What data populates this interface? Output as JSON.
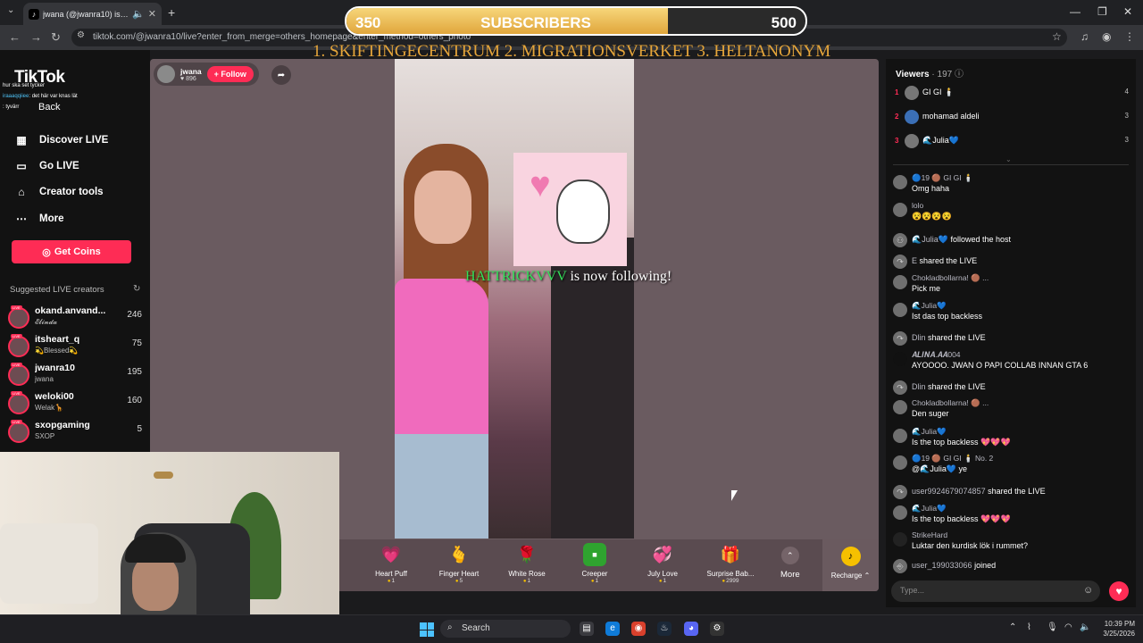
{
  "browser": {
    "tab_title": "jwana (@jwanra10) is LIVE",
    "url": "tiktok.com/@jwanra10/live?enter_from_merge=others_homepage&enter_method=others_photo"
  },
  "sidebar": {
    "logo": "TikTok",
    "back_label": "Back",
    "nav": [
      {
        "label": "Discover LIVE",
        "icon": "discover-icon"
      },
      {
        "label": "Go LIVE",
        "icon": "camera-icon"
      },
      {
        "label": "Creator tools",
        "icon": "creator-tools-icon"
      },
      {
        "label": "More",
        "icon": "more-icon"
      }
    ],
    "coins_button": "Get Coins",
    "suggested_heading": "Suggested LIVE creators",
    "creators": [
      {
        "name": "okand.anvand...",
        "sub": "𝓔𝓵𝓲𝓷𝓭𝓪",
        "count": "246"
      },
      {
        "name": "itsheart_q",
        "sub": "💫Blessed💫",
        "count": "75"
      },
      {
        "name": "jwanra10",
        "sub": "jwana",
        "count": "195"
      },
      {
        "name": "weloki00",
        "sub": "Welak🦒",
        "count": "160"
      },
      {
        "name": "sxopgaming",
        "sub": "SXOP",
        "count": "5"
      }
    ]
  },
  "overlay_chat": [
    {
      "name": "",
      "text": "hur ska set tycker"
    },
    {
      "name": "iraaaqqiiee",
      "text": ": det här var knas lät"
    },
    {
      "name": "",
      "text": ": tyvärr"
    }
  ],
  "stream": {
    "host_name": "jwana",
    "host_likes": "♥ 896",
    "follow_label": "+ Follow",
    "follow_notice_user": "HATTRICKVVV",
    "follow_notice_text": " is now following!",
    "gifts": [
      {
        "name": "Heart Puff",
        "price": "1",
        "icon": "heart-puff-icon",
        "glyph": "💗"
      },
      {
        "name": "Finger Heart",
        "price": "5",
        "icon": "finger-heart-icon",
        "glyph": "🫰"
      },
      {
        "name": "White Rose",
        "price": "1",
        "icon": "white-rose-icon",
        "glyph": "🌹"
      },
      {
        "name": "Creeper",
        "price": "1",
        "icon": "creeper-icon",
        "glyph": "👾"
      },
      {
        "name": "July Love",
        "price": "1",
        "icon": "july-love-icon",
        "glyph": "💞"
      },
      {
        "name": "Surprise Bab...",
        "price": "2999",
        "icon": "surprise-box-icon",
        "glyph": "🎁"
      }
    ],
    "more_label": "More",
    "recharge_label": "Recharge ⌃"
  },
  "subscriber_goal": {
    "current": "350",
    "label": "SUBSCRIBERS",
    "target": "500",
    "progress": 0.7
  },
  "ticker_text": "1. SKIFTINGECENTRUM  2. MIGRATIONSVERKET  3. HELTANONYM",
  "viewers": {
    "heading": "Viewers",
    "count": "· 197",
    "ranks": [
      {
        "rank": "1",
        "name": "GI GI 🕯️",
        "score": "4"
      },
      {
        "rank": "2",
        "name": "mohamad aldeli",
        "score": "3"
      },
      {
        "rank": "3",
        "name": "🌊Julia💙",
        "score": "3"
      }
    ]
  },
  "chat": [
    {
      "name": "🔵19 🟤 GI GI 🕯️",
      "text": "Omg haha"
    },
    {
      "name": "lolo",
      "text": "😵😵😵😵"
    },
    {
      "name": "🌊Julia💙",
      "inline": "followed the host"
    },
    {
      "name": "E",
      "inline": "shared the LIVE"
    },
    {
      "name": "Chokladbollarna! 🟤 ...",
      "text": "Pick me"
    },
    {
      "name": "🌊Julia💙",
      "text": "Ist das top backless"
    },
    {
      "name": "Dlin",
      "inline": "shared the LIVE"
    },
    {
      "name": "𝑨𝑳𝑰𝑵𝑨.𝑨𝑨004",
      "text": "AYOOOO. JWAN O PAPI COLLAB INNAN GTA 6"
    },
    {
      "name": "Dlin",
      "inline": "shared the LIVE"
    },
    {
      "name": "Chokladbollarna! 🟤 ...",
      "text": "Den suger"
    },
    {
      "name": "🌊Julia💙",
      "text": "Is the top backless 💖💖💖"
    },
    {
      "name": "🔵19 🟤 GI GI 🕯️  No. 2",
      "text": "@🌊Julia💙 ye"
    },
    {
      "name": "user9924679074857",
      "inline": "shared the LIVE"
    },
    {
      "name": "🌊Julia💙",
      "text": "Is the top backless 💖💖💖"
    },
    {
      "name": "StrikeHard",
      "text": "Luktar den kurdisk lök i rummet?"
    },
    {
      "name": "user_199033066",
      "inline": "joined"
    }
  ],
  "chat_input_placeholder": "Type...",
  "taskbar": {
    "search_label": "Search",
    "time": "10:39 PM",
    "date": "3/25/2026"
  }
}
